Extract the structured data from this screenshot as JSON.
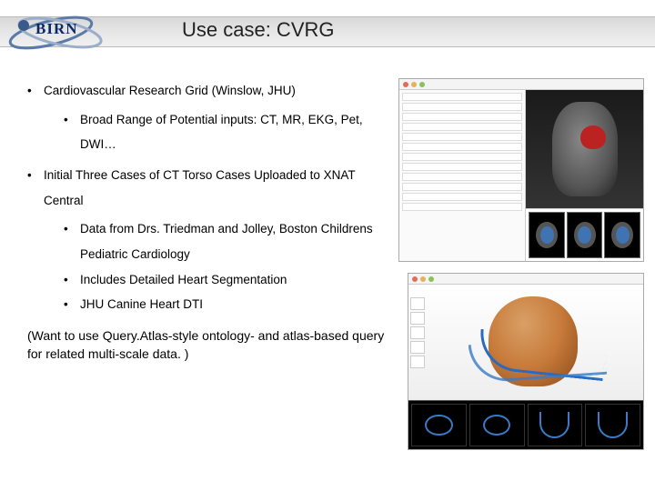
{
  "logo": {
    "text": "BIRN"
  },
  "title": "Use case: CVRG",
  "bullets": [
    {
      "text": "Cardiovascular Research Grid (Winslow, JHU)",
      "sub": [
        {
          "text": "Broad Range of Potential inputs: CT, MR, EKG, Pet, DWI…"
        }
      ]
    },
    {
      "text": "Initial Three Cases of CT Torso Cases Uploaded to XNAT Central",
      "sub": [
        {
          "text": "Data from Drs. Triedman and Jolley, Boston Childrens Pediatric Cardiology"
        },
        {
          "text": "Includes Detailed Heart Segmentation"
        },
        {
          "text": "JHU Canine Heart DTI"
        }
      ]
    }
  ],
  "footnote": "(Want to use Query.Atlas-style ontology- and atlas-based query for related multi-scale data. )"
}
